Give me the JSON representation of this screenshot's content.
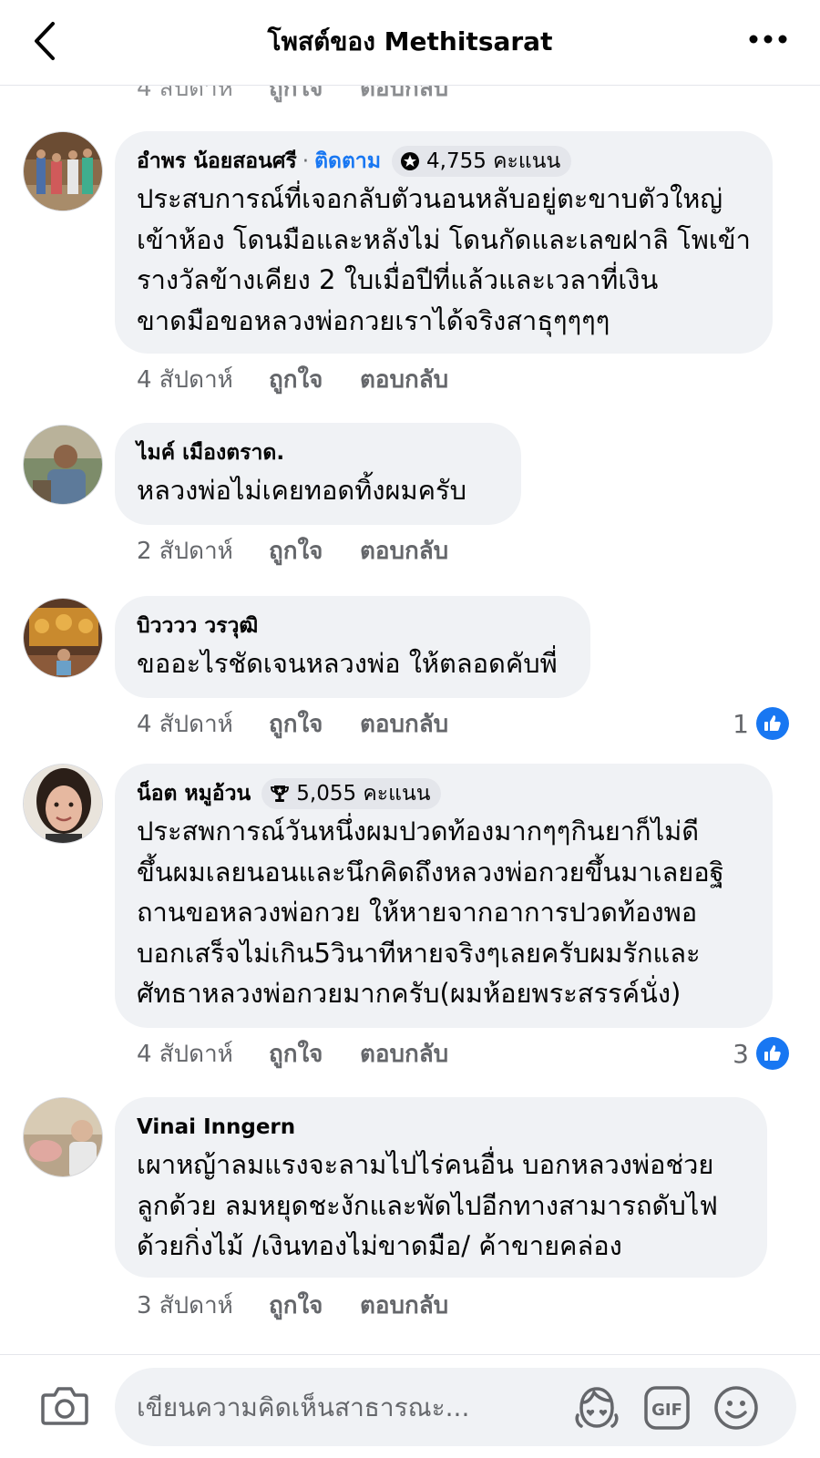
{
  "header": {
    "title": "โพสต์ของ Methitsarat"
  },
  "partial_above": {
    "time": "4 สัปดาห์",
    "like": "ถูกใจ",
    "reply": "ตอบกลับ"
  },
  "comments": [
    {
      "author": "อำพร น้อยสอนศรี",
      "separator": "·",
      "follow": "ติดตาม",
      "badge": "4,755 คะแนน",
      "lines": [
        "ประสบการณ์ที่เจอกลับตัวนอนหลับอยู่ตะขาบตัวใหญ่",
        "เข้าห้อง โดนมือและหลังไม่ โดนกัดและเลขฝาลิ โพเข้า",
        "รางวัลข้างเคียง 2 ใบเมื่อปีที่แล้วและเวลาที่เงิน",
        "ขาดมือขอหลวงพ่อกวยเราได้จริงสาธุๆๆๆๆ"
      ],
      "time": "4 สัปดาห์",
      "like": "ถูกใจ",
      "reply": "ตอบกลับ"
    },
    {
      "author": "ไมค์ เมืองตราด.",
      "lines": [
        "หลวงพ่อไม่เคยทอดทิ้งผมครับ"
      ],
      "time": "2 สัปดาห์",
      "like": "ถูกใจ",
      "reply": "ตอบกลับ"
    },
    {
      "author": "บิวววว วรวุฒิ",
      "lines": [
        "ขออะไรชัดเจนหลวงพ่อ ให้ตลอดคับพี่"
      ],
      "time": "4 สัปดาห์",
      "like": "ถูกใจ",
      "reply": "ตอบกลับ",
      "reaction_count": "1"
    },
    {
      "author": "น็อต หมูอ้วน",
      "badge": "5,055 คะแนน",
      "lines": [
        "ประสพการณ์วันหนึ่งผมปวดท้องมากๆๆกินยาก็ไม่ดี",
        "ขึ้นผมเลยนอนและนึกคิดถึงหลวงพ่อกวยขึ้นมาเลยอฐิ",
        "ถานขอหลวงพ่อกวย ให้หายจากอาการปวดท้องพอ",
        "บอกเสร็จไม่เกิน5วินาทีหายจริงๆเลยครับผมรักและ",
        "ศัทธาหลวงพ่อกวยมากครับ(ผมห้อยพระสรรค์นั่ง)"
      ],
      "time": "4 สัปดาห์",
      "like": "ถูกใจ",
      "reply": "ตอบกลับ",
      "reaction_count": "3"
    },
    {
      "author": "Vinai Inngern",
      "lines": [
        "เผาหญ้าลมแรงจะลามไปไร่คนอื่น บอกหลวงพ่อช่วย",
        "ลูกด้วย ลมหยุดชะงักและพัดไปอีกทางสามารถดับไฟ",
        "ด้วยกิ่งไม้ /เงินทองไม่ขาดมือ/ ค้าขายคล่อง"
      ],
      "time": "3 สัปดาห์",
      "like": "ถูกใจ",
      "reply": "ตอบกลับ"
    }
  ],
  "composer": {
    "placeholder": "เขียนความคิดเห็นสาธารณะ...",
    "gif_label": "GIF"
  },
  "colors": {
    "accent": "#1877f2",
    "bubble": "#f0f2f5",
    "muted_text": "#65676b",
    "text": "#050505"
  },
  "icons": [
    "back-arrow-icon",
    "more-options-icon",
    "badge-icon",
    "trophy-icon",
    "like-thumb-icon",
    "camera-icon",
    "avatar-sticker-icon",
    "gif-icon",
    "emoji-icon"
  ]
}
